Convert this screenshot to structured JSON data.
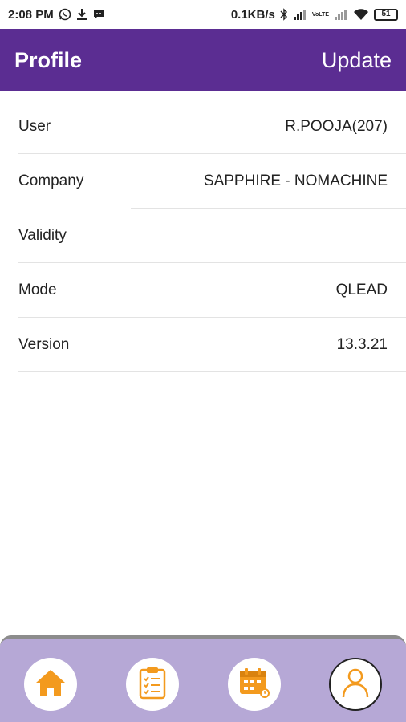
{
  "status_bar": {
    "time": "2:08 PM",
    "net_speed": "0.1KB/s",
    "battery": "51",
    "network_label": "VoLTE"
  },
  "header": {
    "title": "Profile",
    "update_label": "Update"
  },
  "profile": {
    "rows": [
      {
        "label": "User",
        "value": "R.POOJA(207)"
      },
      {
        "label": "Company",
        "value": "SAPPHIRE - NOMACHINE"
      },
      {
        "label": "Validity",
        "value": ""
      },
      {
        "label": "Mode",
        "value": "QLEAD"
      },
      {
        "label": "Version",
        "value": "13.3.21"
      }
    ]
  },
  "bottom_nav": {
    "items": [
      {
        "icon": "home-icon"
      },
      {
        "icon": "clipboard-checklist-icon"
      },
      {
        "icon": "calendar-icon"
      },
      {
        "icon": "user-icon",
        "active": true
      }
    ]
  },
  "colors": {
    "app_bar": "#5b2d92",
    "nav_bar": "#b6a8d6",
    "icon_orange": "#f39a1e"
  }
}
